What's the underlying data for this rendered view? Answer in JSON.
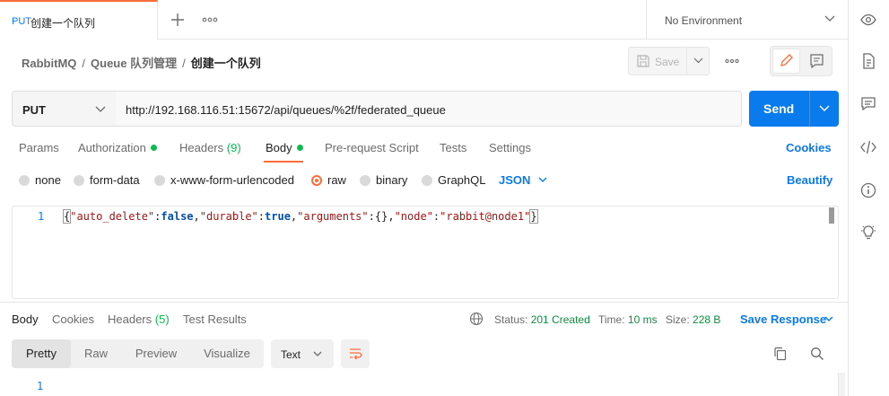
{
  "tab": {
    "method": "PUT",
    "title": "创建一个队列"
  },
  "environment": {
    "label": "No Environment"
  },
  "breadcrumb": {
    "parts": [
      "RabbitMQ",
      "Queue 队列管理"
    ],
    "current": "创建一个队列"
  },
  "toolbar": {
    "save_label": "Save"
  },
  "request": {
    "method": "PUT",
    "url": "http://192.168.116.51:15672/api/queues/%2f/federated_queue",
    "send_label": "Send"
  },
  "request_tabs": {
    "params": "Params",
    "authorization": "Authorization",
    "headers": "Headers",
    "headers_count": "(9)",
    "body": "Body",
    "prerequest": "Pre-request Script",
    "tests": "Tests",
    "settings": "Settings",
    "cookies": "Cookies"
  },
  "body_types": {
    "none": "none",
    "form_data": "form-data",
    "urlencoded": "x-www-form-urlencoded",
    "raw": "raw",
    "binary": "binary",
    "graphql": "GraphQL",
    "format": "JSON",
    "beautify": "Beautify"
  },
  "editor": {
    "line_number": "1",
    "tokens": {
      "open": "{",
      "k1": "\"auto_delete\"",
      "c1": ":",
      "v1": "false",
      "s1": ",",
      "k2": "\"durable\"",
      "c2": ":",
      "v2": "true",
      "s2": ",",
      "k3": "\"arguments\"",
      "c3": ":",
      "v3": "{}",
      "s3": ",",
      "k4": "\"node\"",
      "c4": ":",
      "v4": "\"rabbit@node1\"",
      "close": "}"
    }
  },
  "response_tabs": {
    "body": "Body",
    "cookies": "Cookies",
    "headers": "Headers",
    "headers_count": "(5)",
    "test_results": "Test Results"
  },
  "response_meta": {
    "status_label": "Status:",
    "status_value": "201 Created",
    "time_label": "Time:",
    "time_value": "10 ms",
    "size_label": "Size:",
    "size_value": "228 B",
    "save_response": "Save Response"
  },
  "response_view": {
    "modes": [
      "Pretty",
      "Raw",
      "Preview",
      "Visualize"
    ],
    "active_mode": "Pretty",
    "format": "Text",
    "line_number": "1"
  },
  "colors": {
    "accent": "#ff6c37",
    "primary": "#097bed",
    "success": "#0cbb52"
  }
}
